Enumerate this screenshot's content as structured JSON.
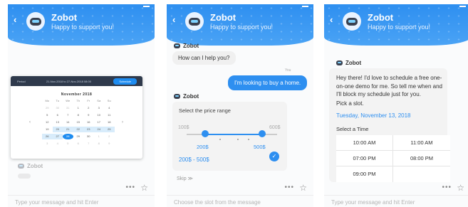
{
  "bot": {
    "name": "Zobot",
    "tagline": "Happy to support you!"
  },
  "panel1": {
    "calendar": {
      "from_label": "Period",
      "range_text": "21-Nov-2018 to 27-Nov-2018 08:00",
      "schedule_button": "Schedule",
      "month": "November 2018",
      "weekdays": [
        "Mo",
        "Tu",
        "We",
        "Th",
        "Fr",
        "Sa",
        "Su"
      ],
      "days": [
        "29",
        "30",
        "31",
        "1",
        "2",
        "3",
        "4",
        "5",
        "6",
        "7",
        "8",
        "9",
        "10",
        "11",
        "12",
        "13",
        "14",
        "15",
        "16",
        "17",
        "18",
        "19",
        "20",
        "21",
        "22",
        "23",
        "24",
        "25",
        "26",
        "27",
        "28",
        "29",
        "30",
        "1",
        "2",
        "3",
        "4",
        "5",
        "6",
        "7",
        "8",
        "9"
      ]
    },
    "faded_bot": "Zobot",
    "input_placeholder": "Type your message and hit Enter"
  },
  "panel2": {
    "greeting": "How can I help you?",
    "you_label": "You",
    "user_msg": "I'm looking to buy a home.",
    "price_title": "Select the price range",
    "min": "100$",
    "max": "600$",
    "low_value": "200$",
    "high_value": "500$",
    "range_text": "200$ - 500$",
    "skip": "Skip ≫",
    "input_placeholder": "Choose the slot from the message"
  },
  "panel3": {
    "message": "Hey there! I'd love to schedule a free one-on-one demo for me. So tell me when and I'll block my schedule just for you.",
    "pick": "Pick a slot.",
    "date": "Tuesday, November 13, 2018",
    "select_time": "Select a Time",
    "times": [
      "10:00 AM",
      "11:00 AM",
      "07:00 PM",
      "08:00 PM",
      "09:00 PM",
      ""
    ],
    "input_placeholder": "Type your message and hit Enter"
  },
  "colors": {
    "accent": "#2e8ff0",
    "header": "#3a99f2"
  },
  "icons": [
    "back-arrow-icon",
    "bot-avatar-icon",
    "close-icon",
    "more-icon",
    "star-icon",
    "check-icon",
    "chevron-left-icon",
    "chevron-right-icon"
  ]
}
